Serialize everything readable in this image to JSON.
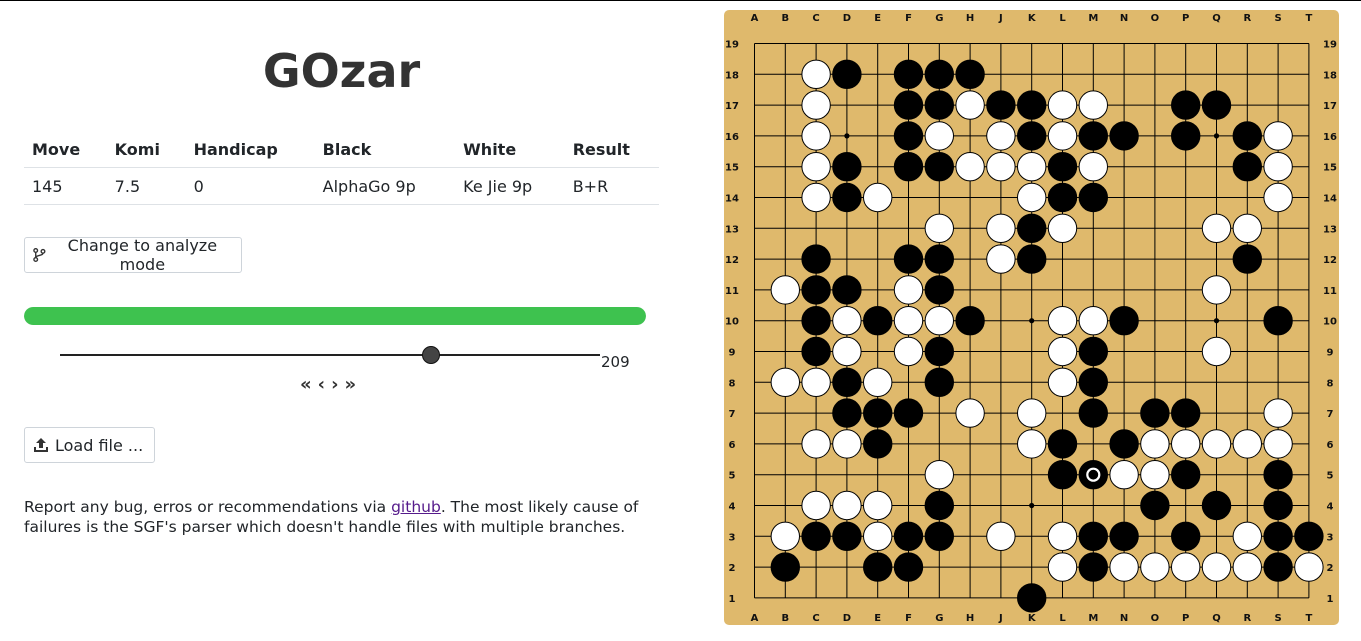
{
  "app": {
    "title": "GOzar"
  },
  "info_table": {
    "headers": [
      "Move",
      "Komi",
      "Handicap",
      "Black",
      "White",
      "Result"
    ],
    "values": [
      "145",
      "7.5",
      "0",
      "AlphaGo 9p",
      "Ke Jie 9p",
      "B+R"
    ]
  },
  "buttons": {
    "analyze_label": "Change to analyze mode",
    "load_label": "Load file ..."
  },
  "progress": {
    "fraction": 1.0,
    "color": "#3ec24f"
  },
  "slider": {
    "value": "209",
    "fraction": 0.685
  },
  "nav": {
    "first": "«",
    "prev": "‹",
    "next": "›",
    "last": "»"
  },
  "report": {
    "before": "Report any bug, erros or recommendations via ",
    "link": "github",
    "after": ". The most likely cause of failures is the SGF's parser which doesn't handle files with multiple branches."
  },
  "board": {
    "size": 19,
    "background": "#dfb96c",
    "columns": [
      "A",
      "B",
      "C",
      "D",
      "E",
      "F",
      "G",
      "H",
      "J",
      "K",
      "L",
      "M",
      "N",
      "O",
      "P",
      "Q",
      "R",
      "S",
      "T"
    ],
    "rows": [
      "19",
      "18",
      "17",
      "16",
      "15",
      "14",
      "13",
      "12",
      "11",
      "10",
      "9",
      "8",
      "7",
      "6",
      "5",
      "4",
      "3",
      "2",
      "1"
    ],
    "grid": [
      "...................",
      "..wb.bbb...........",
      "..w..bbwbbww..bb...",
      "..w..bw.wbwbb.b.bw.",
      "..wb.bbwwwbw....bw.",
      "..wbw....wbb.....w.",
      "......w.wbw....ww..",
      "..b..bb.wb......b..",
      ".wbb.wb........w...",
      "..bwbwwb..wwb....b.",
      "..bw.wb...wb...w...",
      ".wwbw.b...wb.......",
      "...bbb.w.w.b.bb..w.",
      "..wwb....wb.bwwwww.",
      "......w...bbwwb..b.",
      "..www.b......b.b.b.",
      ".wbbwbb.w.wbb.b.wbb",
      ".b..bb....wbwwwwwbw",
      ".........b........."
    ],
    "last_move": "M5",
    "hoshi": [
      "D16",
      "K16",
      "Q16",
      "D10",
      "K10",
      "Q10",
      "D4",
      "K4",
      "Q4"
    ]
  }
}
